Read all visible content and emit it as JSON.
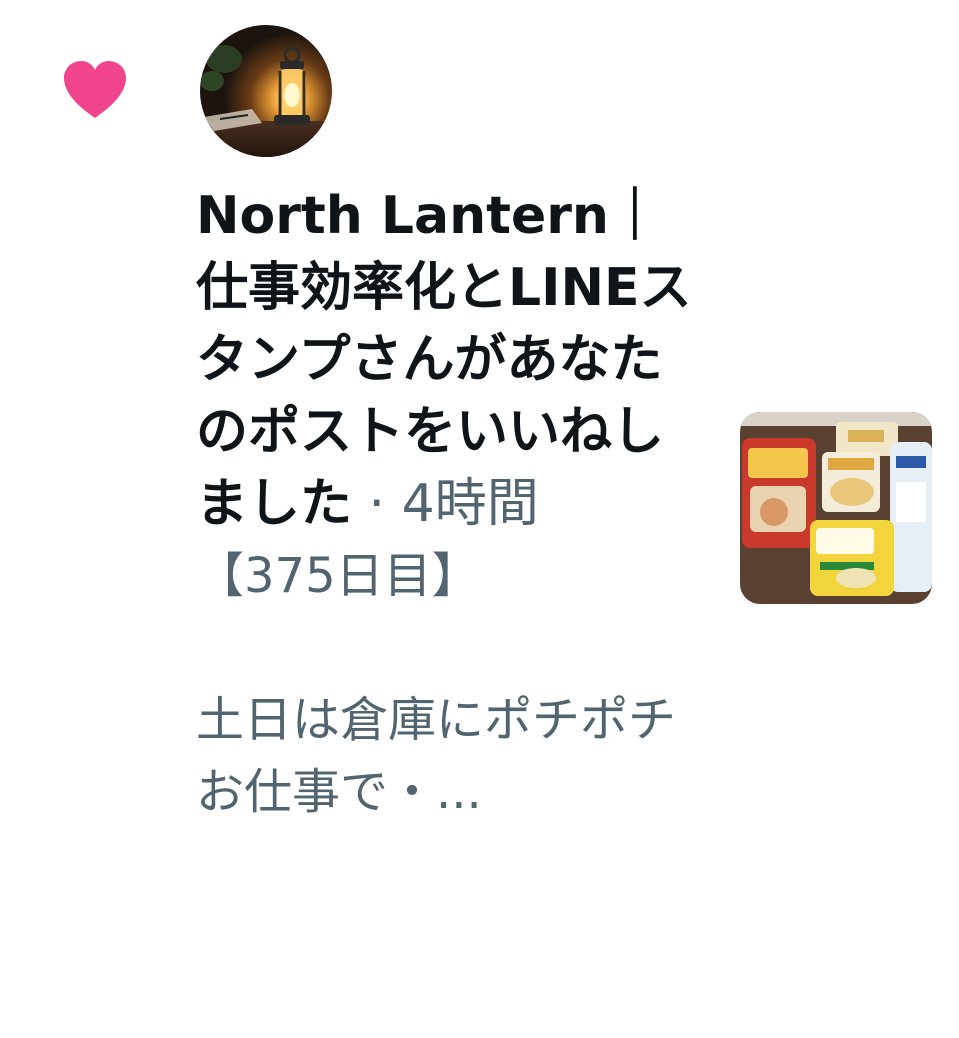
{
  "notification": {
    "type_icon": "heart-icon",
    "avatar_icon": "lantern-avatar",
    "user_name": "North Lantern",
    "user_name_suffix": "｜仕事効率化とLINEスタンプさん",
    "action_text": "があなたのポストをいいねしました",
    "separator": "·",
    "timestamp": "4時間",
    "post_text": "【375日目】\n\n土日は倉庫にポチポチお仕事で・...",
    "thumbnail_icon": "bread-packages-photo",
    "colors": {
      "heart": "#f0458c",
      "primary_text": "#0f1419",
      "secondary_text": "#536471"
    }
  }
}
